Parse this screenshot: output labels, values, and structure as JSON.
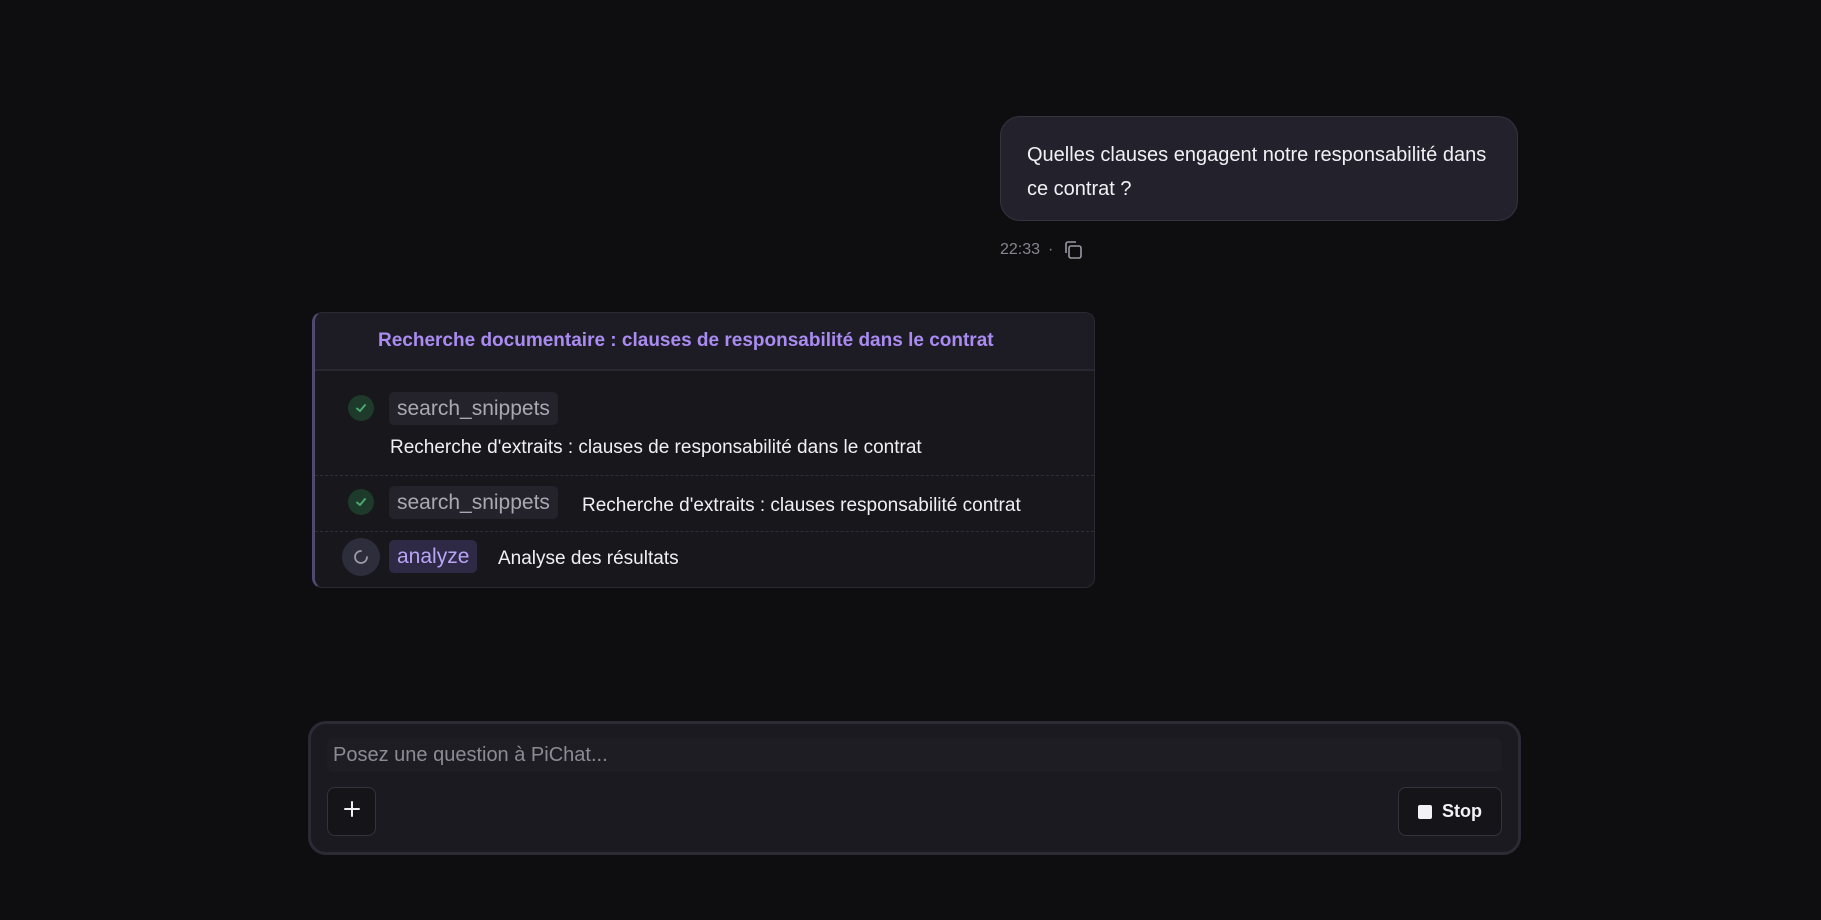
{
  "conversation": {
    "user_message": {
      "text": "Quelles clauses engagent notre responsabilité dans ce contrat ?",
      "time": "22:33",
      "separator": "·",
      "copy_icon": "copy-icon"
    },
    "tool_panel": {
      "title": "Recherche documentaire : clauses de responsabilité dans le contrat",
      "steps": [
        {
          "status": "done",
          "tool": "search_snippets",
          "description": "Recherche d'extraits : clauses de responsabilité dans le contrat"
        },
        {
          "status": "done",
          "tool": "search_snippets",
          "description": "Recherche d'extraits : clauses responsabilité contrat"
        },
        {
          "status": "running",
          "tool": "analyze",
          "description": "Analyse des résultats"
        }
      ]
    }
  },
  "composer": {
    "placeholder": "Posez une question à PiChat...",
    "value": "",
    "add_icon": "plus-icon",
    "stop_label": "Stop",
    "stop_icon": "stop-square-icon"
  },
  "colors": {
    "background": "#0e0e11",
    "accent": "#a98bf2",
    "success": "#4ca66f",
    "bubble": "#23222c"
  }
}
